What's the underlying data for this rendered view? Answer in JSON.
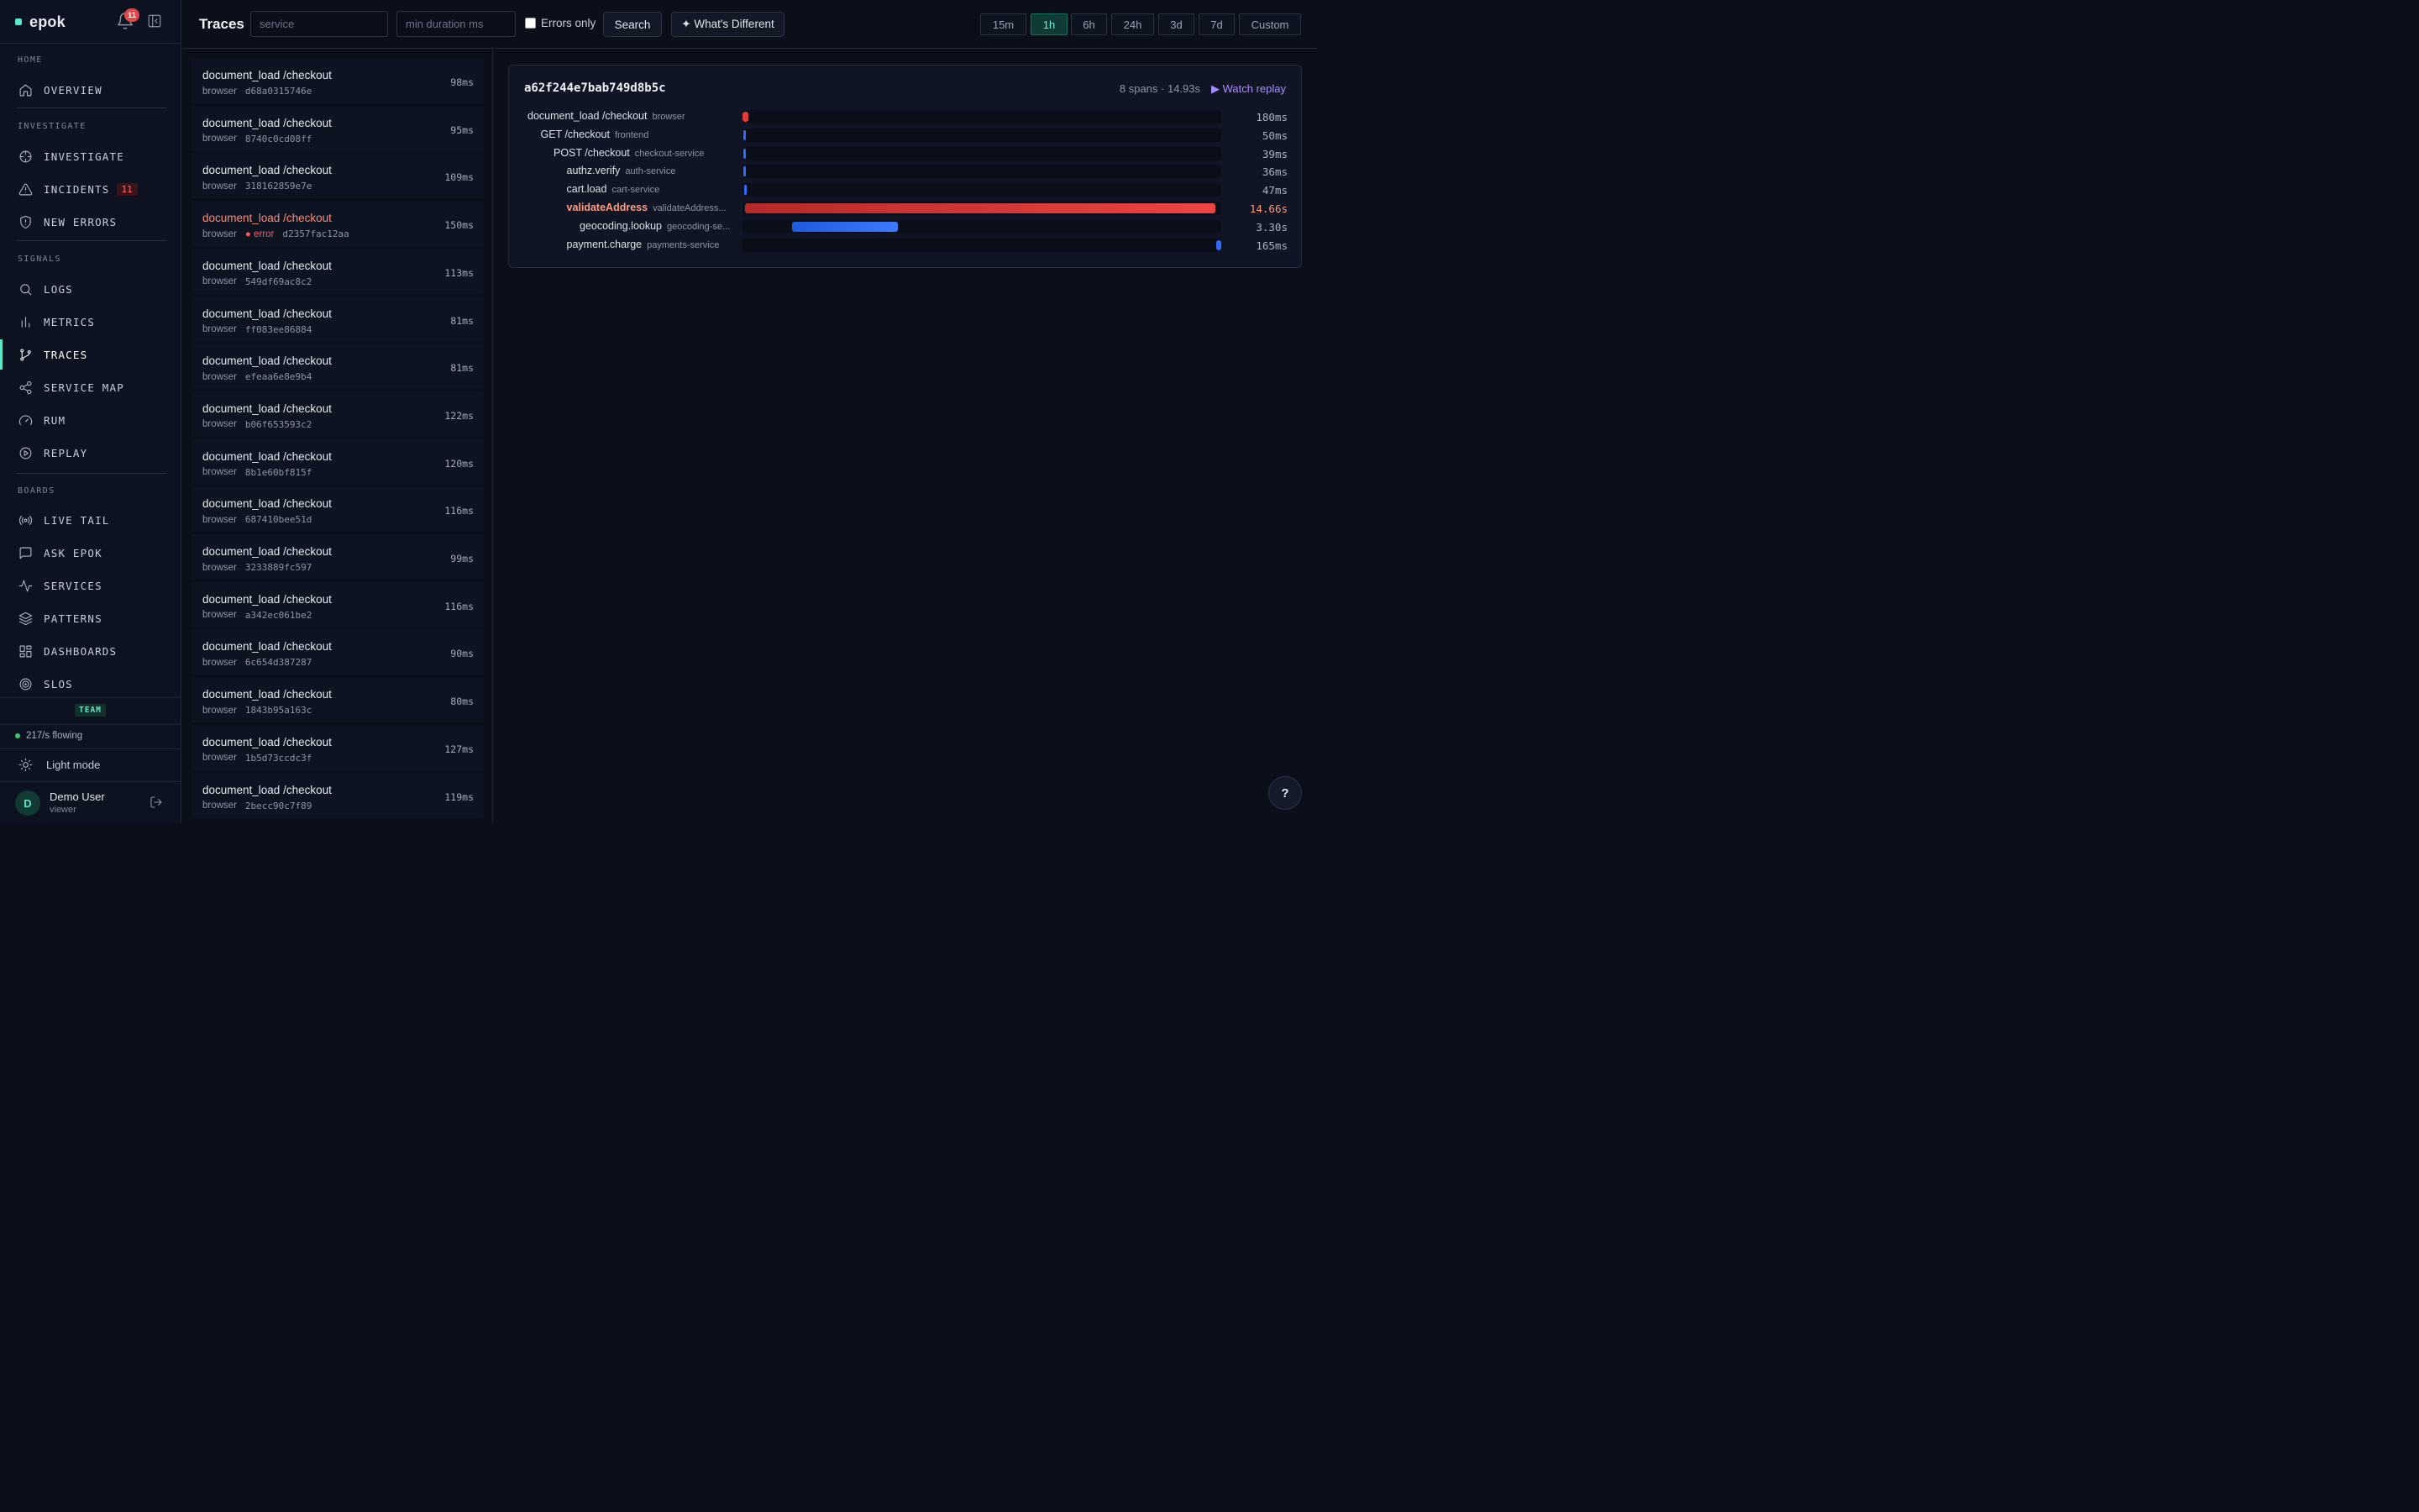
{
  "app": {
    "name": "epok",
    "notifications": "11"
  },
  "sidebar": {
    "sections": [
      {
        "title": "HOME",
        "items": [
          {
            "label": "OVERVIEW",
            "icon": "home-icon"
          }
        ]
      },
      {
        "title": "INVESTIGATE",
        "items": [
          {
            "label": "INVESTIGATE",
            "icon": "crosshair-icon"
          },
          {
            "label": "INCIDENTS",
            "icon": "warning-icon",
            "count": "11"
          },
          {
            "label": "NEW ERRORS",
            "icon": "shield-icon"
          }
        ]
      },
      {
        "title": "SIGNALS",
        "items": [
          {
            "label": "LOGS",
            "icon": "search-icon"
          },
          {
            "label": "METRICS",
            "icon": "bar-chart-icon"
          },
          {
            "label": "TRACES",
            "icon": "git-branch-icon",
            "active": true
          },
          {
            "label": "SERVICE MAP",
            "icon": "share-icon"
          },
          {
            "label": "RUM",
            "icon": "gauge-icon"
          },
          {
            "label": "REPLAY",
            "icon": "play-circle-icon"
          }
        ]
      },
      {
        "title": "BOARDS",
        "items": [
          {
            "label": "LIVE TAIL",
            "icon": "radio-icon"
          },
          {
            "label": "ASK EPOK",
            "icon": "chat-icon"
          },
          {
            "label": "SERVICES",
            "icon": "activity-icon"
          },
          {
            "label": "PATTERNS",
            "icon": "layers-icon"
          },
          {
            "label": "DASHBOARDS",
            "icon": "dashboard-icon"
          },
          {
            "label": "SLOS",
            "icon": "target-icon"
          }
        ]
      }
    ],
    "team_label": "TEAM",
    "flow": "217/s flowing",
    "light_mode": "Light mode",
    "user": {
      "initial": "D",
      "name": "Demo User",
      "role": "viewer"
    }
  },
  "topbar": {
    "title": "Traces",
    "service_placeholder": "service",
    "duration_placeholder": "min duration ms",
    "errors_only": "Errors only",
    "search": "Search",
    "whats_different": "✦ What's Different",
    "ranges": [
      "15m",
      "1h",
      "6h",
      "24h",
      "3d",
      "7d",
      "Custom"
    ],
    "active_range": "1h"
  },
  "traces": [
    {
      "op": "document_load /checkout",
      "service": "browser",
      "id": "d68a0315746e",
      "duration": "98ms"
    },
    {
      "op": "document_load /checkout",
      "service": "browser",
      "id": "8740c0cd08ff",
      "duration": "95ms"
    },
    {
      "op": "document_load /checkout",
      "service": "browser",
      "id": "318162859e7e",
      "duration": "109ms"
    },
    {
      "op": "document_load /checkout",
      "service": "browser",
      "id": "d2357fac12aa",
      "duration": "150ms",
      "error": "● error"
    },
    {
      "op": "document_load /checkout",
      "service": "browser",
      "id": "549df69ac8c2",
      "duration": "113ms"
    },
    {
      "op": "document_load /checkout",
      "service": "browser",
      "id": "ff083ee86884",
      "duration": "81ms"
    },
    {
      "op": "document_load /checkout",
      "service": "browser",
      "id": "efeaa6e8e9b4",
      "duration": "81ms"
    },
    {
      "op": "document_load /checkout",
      "service": "browser",
      "id": "b06f653593c2",
      "duration": "122ms"
    },
    {
      "op": "document_load /checkout",
      "service": "browser",
      "id": "8b1e60bf815f",
      "duration": "120ms"
    },
    {
      "op": "document_load /checkout",
      "service": "browser",
      "id": "687410bee51d",
      "duration": "116ms"
    },
    {
      "op": "document_load /checkout",
      "service": "browser",
      "id": "3233889fc597",
      "duration": "99ms"
    },
    {
      "op": "document_load /checkout",
      "service": "browser",
      "id": "a342ec061be2",
      "duration": "116ms"
    },
    {
      "op": "document_load /checkout",
      "service": "browser",
      "id": "6c654d387287",
      "duration": "90ms"
    },
    {
      "op": "document_load /checkout",
      "service": "browser",
      "id": "1843b95a163c",
      "duration": "80ms"
    },
    {
      "op": "document_load /checkout",
      "service": "browser",
      "id": "1b5d73ccdc3f",
      "duration": "127ms"
    },
    {
      "op": "document_load /checkout",
      "service": "browser",
      "id": "2becc90c7f89",
      "duration": "119ms"
    }
  ],
  "detail": {
    "trace_id": "a62f244e7bab749d8b5c",
    "meta": "8 spans · 14.93s",
    "watch_replay": "▶ Watch replay",
    "spans": [
      {
        "name": "document_load /checkout",
        "service": "browser",
        "duration": "180ms",
        "depth": 0,
        "start": 0.0,
        "fraction": 0.012,
        "color": "#e03a3a"
      },
      {
        "name": "GET /checkout",
        "service": "frontend",
        "duration": "50ms",
        "depth": 1,
        "start": 0.001,
        "fraction": 0.0034,
        "color": "#2f6bff"
      },
      {
        "name": "POST /checkout",
        "service": "checkout-service",
        "duration": "39ms",
        "depth": 2,
        "start": 0.002,
        "fraction": 0.0026,
        "color": "#2f6bff"
      },
      {
        "name": "authz.verify",
        "service": "auth-service",
        "duration": "36ms",
        "depth": 3,
        "start": 0.002,
        "fraction": 0.0024,
        "color": "#2f6bff"
      },
      {
        "name": "cart.load",
        "service": "cart-service",
        "duration": "47ms",
        "depth": 3,
        "start": 0.003,
        "fraction": 0.0031,
        "color": "#2f6bff"
      },
      {
        "name": "validateAddress",
        "service": "validateAddress...",
        "duration": "14.66s",
        "depth": 3,
        "start": 0.005,
        "fraction": 0.982,
        "color": "#e03a3a",
        "hot": true
      },
      {
        "name": "geocoding.lookup",
        "service": "geocoding-se...",
        "duration": "3.30s",
        "depth": 4,
        "start": 0.104,
        "fraction": 0.221,
        "color": "#2f6bff"
      },
      {
        "name": "payment.charge",
        "service": "payments-service",
        "duration": "165ms",
        "depth": 3,
        "start": 0.989,
        "fraction": 0.011,
        "color": "#2f6bff"
      }
    ]
  }
}
